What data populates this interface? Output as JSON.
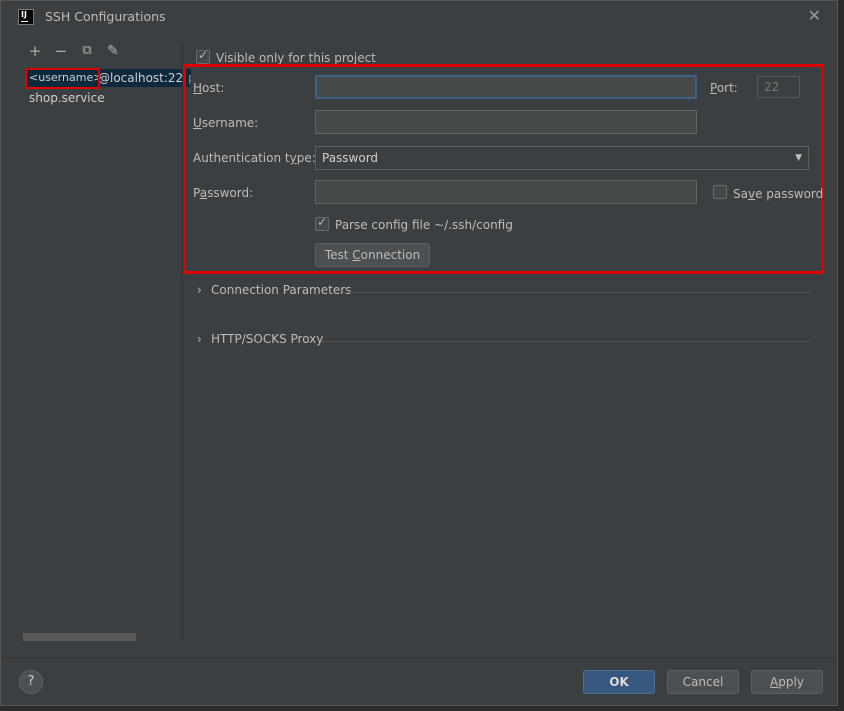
{
  "window": {
    "title": "SSH Configurations",
    "app_icon_text": "IJ"
  },
  "toolbar": {
    "add": "+",
    "remove": "−",
    "copy": "⧉",
    "edit": "✎"
  },
  "tree": {
    "selected_user": "<username>",
    "selected_host": "@localhost:22",
    "selected_suffix": "p",
    "item2": "shop.service"
  },
  "form": {
    "visible_only_label": "Visible only for this project",
    "host_label_u": "H",
    "host_label_rest": "ost:",
    "host_value": "",
    "port_label_u": "P",
    "port_label_rest": "ort:",
    "port_value": "22",
    "username_label_u": "U",
    "username_label_rest": "sername:",
    "username_value": "",
    "auth_label_pre": "Authentication t",
    "auth_label_u": "y",
    "auth_label_rest": "pe:",
    "auth_value": "Password",
    "password_label_pre": "P",
    "password_label_u": "a",
    "password_label_rest": "ssword:",
    "password_value": "",
    "save_password_pre": "Sa",
    "save_password_u": "v",
    "save_password_rest": "e password",
    "parse_config_label": "Parse config file ~/.ssh/config",
    "test_conn_pre": "Test ",
    "test_conn_u": "C",
    "test_conn_rest": "onnection"
  },
  "sections": {
    "connection_params": "Connection Parameters",
    "proxy": "HTTP/SOCKS Proxy"
  },
  "footer": {
    "help": "?",
    "ok": "OK",
    "cancel": "Cancel",
    "apply_u": "A",
    "apply_rest": "pply"
  },
  "colors": {
    "highlight": "#e00000",
    "selection": "#0d293e",
    "primary_button": "#365880"
  }
}
